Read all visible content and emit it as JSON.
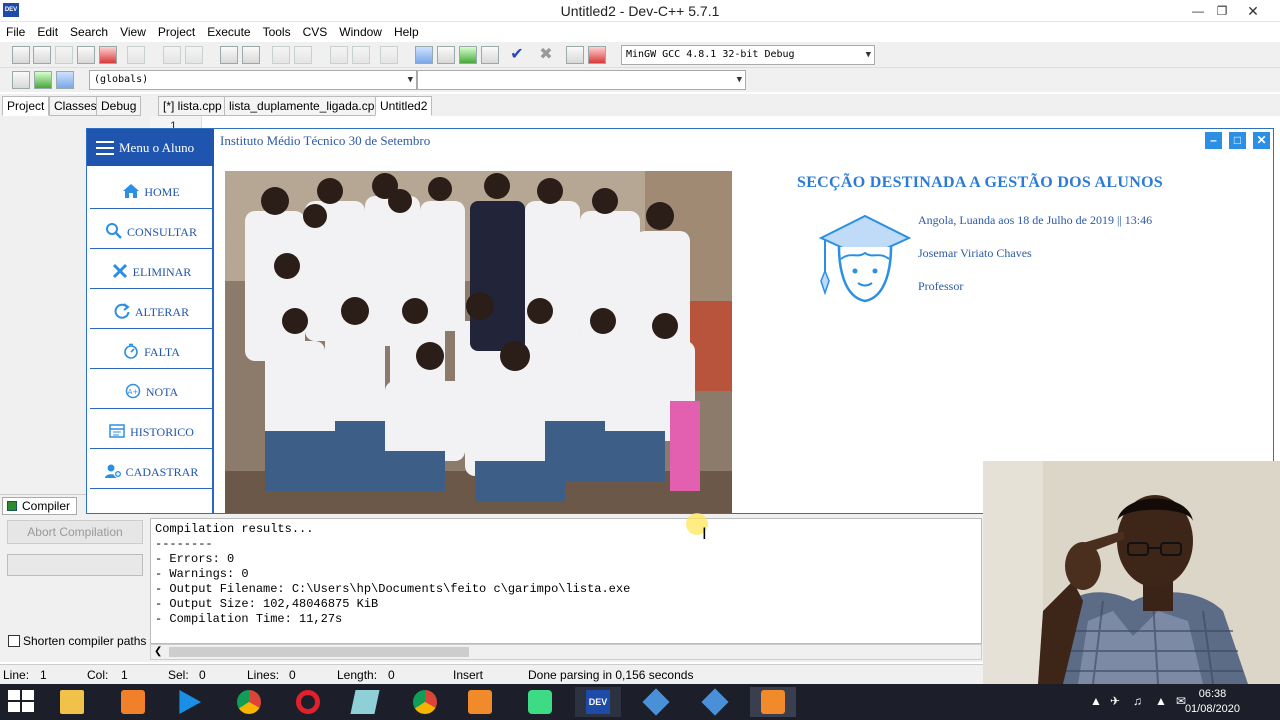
{
  "ide": {
    "title": "Untitled2 - Dev-C++ 5.7.1",
    "menus": [
      "File",
      "Edit",
      "Search",
      "View",
      "Project",
      "Execute",
      "Tools",
      "CVS",
      "Window",
      "Help"
    ],
    "compiler_select": "MinGW GCC 4.8.1 32-bit Debug",
    "scope_select": "(globals)",
    "panel_tabs": [
      "Project",
      "Classes",
      "Debug"
    ],
    "file_tabs": [
      "[*] lista.cpp",
      "lista_duplamente_ligada.cpp",
      "Untitled2"
    ],
    "line_number": "1",
    "compiler_tab": "Compiler",
    "abort_button": "Abort Compilation",
    "shorten_paths": "Shorten compiler paths",
    "log": [
      "Compilation results...",
      "--------",
      "- Errors: 0",
      "- Warnings: 0",
      "- Output Filename: C:\\Users\\hp\\Documents\\feito c\\garimpo\\lista.exe",
      "- Output Size: 102,48046875 KiB",
      "- Compilation Time: 11,27s"
    ],
    "status": {
      "line_label": "Line:",
      "line_value": "1",
      "col_label": "Col:",
      "col_value": "1",
      "sel_label": "Sel:",
      "sel_value": "0",
      "lines_label": "Lines:",
      "lines_value": "0",
      "length_label": "Length:",
      "length_value": "0",
      "mode": "Insert",
      "message": "Done parsing in 0,156 seconds"
    }
  },
  "app": {
    "title": "Instituto Médio Técnico 30 de Setembro",
    "menu_label": "Menu o Aluno",
    "nav": [
      {
        "label": "HOME",
        "icon": "home-icon"
      },
      {
        "label": "CONSULTAR",
        "icon": "search-icon"
      },
      {
        "label": "ELIMINAR",
        "icon": "close-icon"
      },
      {
        "label": "ALTERAR",
        "icon": "refresh-icon"
      },
      {
        "label": "FALTA",
        "icon": "stopwatch-icon"
      },
      {
        "label": "NOTA",
        "icon": "grade-icon"
      },
      {
        "label": "HISTORICO",
        "icon": "history-icon"
      },
      {
        "label": "CADASTRAR",
        "icon": "add-user-icon"
      }
    ],
    "section_title": "SECÇÃO DESTINADA A GESTÃO DOS ALUNOS",
    "info": {
      "date_line": "Angola, Luanda aos 18 de Julho de 2019 || 13:46",
      "user_name": "Josemar Viriato Chaves",
      "role": "Professor"
    },
    "accent": "#1f55ae",
    "title_color": "#2b7bd6"
  },
  "taskbar": {
    "time": "06:38",
    "date": "01/08/2020"
  }
}
